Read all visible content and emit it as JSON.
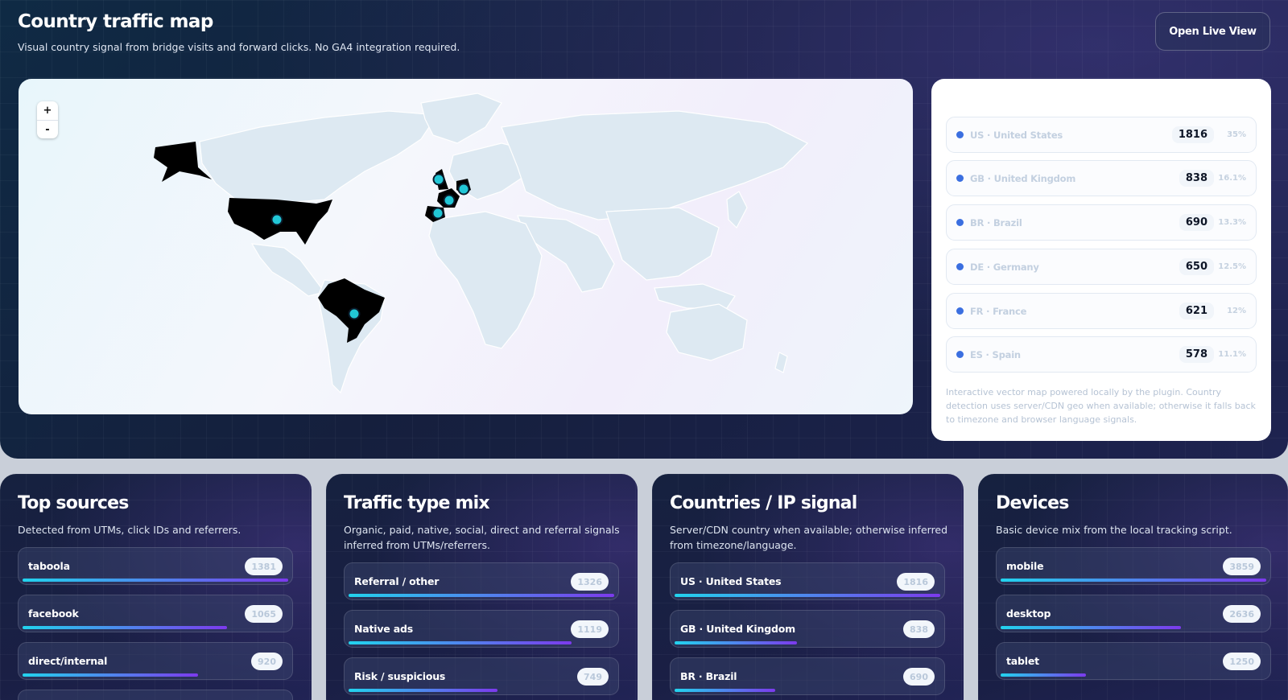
{
  "header": {
    "title": "Country traffic map",
    "subtitle": "Visual country signal from bridge visits and forward clicks. No GA4 integration required.",
    "live_button": "Open Live View"
  },
  "map": {
    "zoom_in": "+",
    "zoom_out": "-",
    "highlighted": [
      "US",
      "GB",
      "BR",
      "DE",
      "FR",
      "ES"
    ],
    "colors": {
      "highlight": "#000000",
      "marker": "#22c7d6",
      "land": "#dde9f2",
      "border": "#ffffff"
    }
  },
  "countries": {
    "rows": [
      {
        "label": "US · United States",
        "count": "1816",
        "pct": "35%"
      },
      {
        "label": "GB · United Kingdom",
        "count": "838",
        "pct": "16.1%"
      },
      {
        "label": "BR · Brazil",
        "count": "690",
        "pct": "13.3%"
      },
      {
        "label": "DE · Germany",
        "count": "650",
        "pct": "12.5%"
      },
      {
        "label": "FR · France",
        "count": "621",
        "pct": "12%"
      },
      {
        "label": "ES · Spain",
        "count": "578",
        "pct": "11.1%"
      }
    ],
    "note": "Interactive vector map powered locally by the plugin. Country detection uses server/CDN geo when available; otherwise it falls back to timezone and browser language signals."
  },
  "panels": {
    "sources": {
      "title": "Top sources",
      "desc": "Detected from UTMs, click IDs and referrers.",
      "items": [
        {
          "label": "taboola",
          "count": "1381",
          "share": 1.0
        },
        {
          "label": "facebook",
          "count": "1065",
          "share": 0.77
        },
        {
          "label": "direct/internal",
          "count": "920",
          "share": 0.66
        }
      ]
    },
    "traffic": {
      "title": "Traffic type mix",
      "desc": "Organic, paid, native, social, direct and referral signals inferred from UTMs/referrers.",
      "items": [
        {
          "label": "Referral / other",
          "count": "1326",
          "share": 1.0
        },
        {
          "label": "Native ads",
          "count": "1119",
          "share": 0.84
        },
        {
          "label": "Risk / suspicious",
          "count": "749",
          "share": 0.56
        }
      ]
    },
    "ip": {
      "title": "Countries / IP signal",
      "desc": "Server/CDN country when available; otherwise inferred from timezone/language.",
      "items": [
        {
          "label": "US · United States",
          "count": "1816",
          "share": 1.0
        },
        {
          "label": "GB · United Kingdom",
          "count": "838",
          "share": 0.46
        },
        {
          "label": "BR · Brazil",
          "count": "690",
          "share": 0.38
        }
      ]
    },
    "devices": {
      "title": "Devices",
      "desc": "Basic device mix from the local tracking script.",
      "items": [
        {
          "label": "mobile",
          "count": "3859",
          "share": 1.0
        },
        {
          "label": "desktop",
          "count": "2636",
          "share": 0.68
        },
        {
          "label": "tablet",
          "count": "1250",
          "share": 0.32
        }
      ]
    }
  }
}
